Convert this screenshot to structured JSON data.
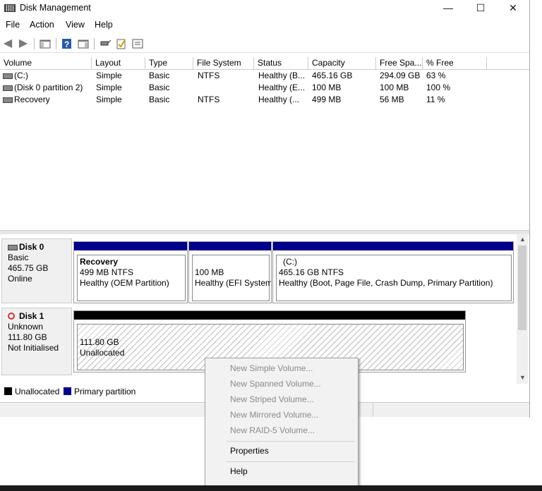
{
  "window": {
    "title": "Disk Management",
    "min": "—",
    "max": "☐",
    "close": "✕"
  },
  "menu": [
    "File",
    "Action",
    "View",
    "Help"
  ],
  "list": {
    "columns": [
      "Volume",
      "Layout",
      "Type",
      "File System",
      "Status",
      "Capacity",
      "Free Spa...",
      "% Free"
    ],
    "rows": [
      [
        "(C:)",
        "Simple",
        "Basic",
        "NTFS",
        "Healthy (B...",
        "465.16 GB",
        "294.09 GB",
        "63 %"
      ],
      [
        "(Disk 0 partition 2)",
        "Simple",
        "Basic",
        "",
        "Healthy (E...",
        "100 MB",
        "100 MB",
        "100 %"
      ],
      [
        "Recovery",
        "Simple",
        "Basic",
        "NTFS",
        "Healthy (...",
        "499 MB",
        "56 MB",
        "11 %"
      ]
    ]
  },
  "disks": [
    {
      "name": "Disk 0",
      "type": "Basic",
      "size": "465.75 GB",
      "state": "Online",
      "partitions": [
        {
          "name": "Recovery",
          "size": "499 MB NTFS",
          "status": "Healthy (OEM Partition)"
        },
        {
          "name": "",
          "size": "100 MB",
          "status": "Healthy (EFI System"
        },
        {
          "name": "(C:)",
          "size": "465.16 GB NTFS",
          "status": "Healthy (Boot, Page File, Crash Dump, Primary Partition)"
        }
      ]
    },
    {
      "name": "Disk 1",
      "type": "Unknown",
      "size": "111.80 GB",
      "state": "Not Initialised",
      "partitions": [
        {
          "size": "111.80 GB",
          "status": "Unallocated"
        }
      ]
    }
  ],
  "legend": {
    "unallocated": "Unallocated",
    "primary": "Primary partition"
  },
  "colors": {
    "primary": "#00008b",
    "unallocated": "#000000"
  },
  "context_menu": {
    "items": [
      "New Simple Volume...",
      "New Spanned Volume...",
      "New Striped Volume...",
      "New Mirrored Volume...",
      "New RAID-5 Volume..."
    ],
    "properties": "Properties",
    "help": "Help"
  }
}
